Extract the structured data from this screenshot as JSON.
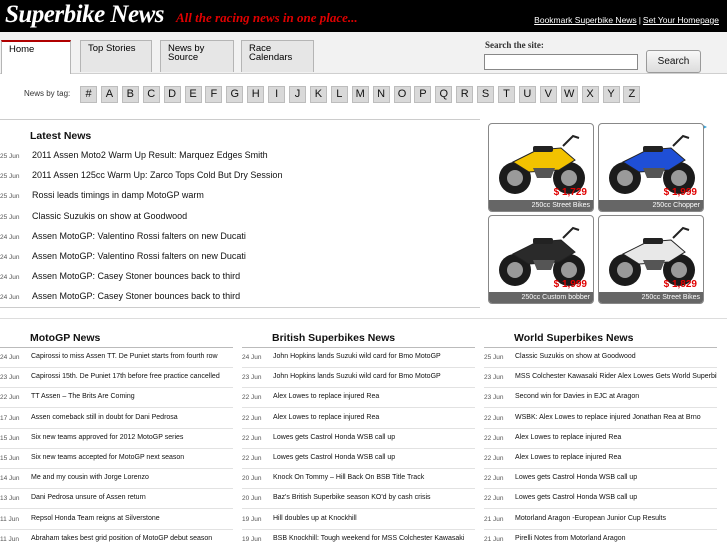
{
  "header": {
    "logo": "Superbike News",
    "tagline": "All the racing news in one place...",
    "link_bookmark": "Bookmark Superbike News",
    "separator": "|",
    "link_homepage": "Set Your Homepage"
  },
  "tabs": [
    {
      "label": "Home",
      "active": true
    },
    {
      "label": "Top Stories"
    },
    {
      "label": "News by Source"
    },
    {
      "label": "Race Calendars"
    }
  ],
  "search": {
    "label": "Search the site:",
    "value": "",
    "button": "Search"
  },
  "tags": {
    "label": "News by tag:",
    "letters": [
      "#",
      "A",
      "B",
      "C",
      "D",
      "E",
      "F",
      "G",
      "H",
      "I",
      "J",
      "K",
      "L",
      "M",
      "N",
      "O",
      "P",
      "Q",
      "R",
      "S",
      "T",
      "U",
      "V",
      "W",
      "X",
      "Y",
      "Z"
    ]
  },
  "latest": {
    "title": "Latest News",
    "items": [
      {
        "date": "25 Jun",
        "title": "2011 Assen Moto2 Warm Up Result: Marquez Edges Smith"
      },
      {
        "date": "25 Jun",
        "title": "2011 Assen 125cc Warm Up: Zarco Tops Cold But Dry Session"
      },
      {
        "date": "25 Jun",
        "title": "Rossi leads timings in damp MotoGP warm"
      },
      {
        "date": "25 Jun",
        "title": "Classic Suzukis on show at Goodwood"
      },
      {
        "date": "24 Jun",
        "title": "Assen MotoGP: Valentino Rossi falters on new Ducati"
      },
      {
        "date": "24 Jun",
        "title": "Assen MotoGP: Valentino Rossi falters on new Ducati"
      },
      {
        "date": "24 Jun",
        "title": "Assen MotoGP: Casey Stoner bounces back to third"
      },
      {
        "date": "24 Jun",
        "title": "Assen MotoGP: Casey Stoner bounces back to third"
      }
    ]
  },
  "ad": {
    "bikes": [
      {
        "price": "$ 1,729",
        "label": "250cc Street Bikes",
        "color": "#f2c200"
      },
      {
        "price": "$ 1,999",
        "label": "250cc Chopper",
        "color": "#1f4fd6"
      },
      {
        "price": "$ 1,999",
        "label": "250cc Custom bobber",
        "color": "#2a2a2a"
      },
      {
        "price": "$ 1,829",
        "label": "250cc Street Bikes",
        "color": "#e8e8e8"
      }
    ]
  },
  "columns": [
    {
      "title": "MotoGP News",
      "items": [
        {
          "date": "24 Jun",
          "title": "Capirossi to miss Assen TT. De Puniet starts from fourth row"
        },
        {
          "date": "23 Jun",
          "title": "Capirossi 15th. De Puniet 17th before free practice cancelled"
        },
        {
          "date": "22 Jun",
          "title": "TT Assen – The Brits Are Coming"
        },
        {
          "date": "17 Jun",
          "title": "Assen comeback still in doubt for Dani Pedrosa"
        },
        {
          "date": "15 Jun",
          "title": "Six new teams approved for 2012 MotoGP series"
        },
        {
          "date": "15 Jun",
          "title": "Six new teams accepted for MotoGP next season"
        },
        {
          "date": "14 Jun",
          "title": "Me and my cousin with Jorge Lorenzo"
        },
        {
          "date": "13 Jun",
          "title": "Dani Pedrosa unsure of Assen return"
        },
        {
          "date": "11 Jun",
          "title": "Repsol Honda Team reigns at Silverstone"
        },
        {
          "date": "11 Jun",
          "title": "Abraham takes best grid position of MotoGP debut season"
        }
      ]
    },
    {
      "title": "British Superbikes News",
      "items": [
        {
          "date": "24 Jun",
          "title": "John Hopkins lands Suzuki wild card for Bmo MotoGP"
        },
        {
          "date": "23 Jun",
          "title": "John Hopkins lands Suzuki wild card for Bmo MotoGP"
        },
        {
          "date": "22 Jun",
          "title": "Alex Lowes to replace injured Rea"
        },
        {
          "date": "22 Jun",
          "title": "Alex Lowes to replace injured Rea"
        },
        {
          "date": "22 Jun",
          "title": "Lowes gets Castrol Honda WSB call up"
        },
        {
          "date": "22 Jun",
          "title": "Lowes gets Castrol Honda WSB call up"
        },
        {
          "date": "20 Jun",
          "title": "Knock On Tommy – Hill Back On BSB Title Track"
        },
        {
          "date": "20 Jun",
          "title": "Baz's British Superbike season KO'd by cash crisis"
        },
        {
          "date": "19 Jun",
          "title": "Hill doubles up at Knockhill"
        },
        {
          "date": "19 Jun",
          "title": "BSB Knockhill: Tough weekend for MSS Colchester Kawasaki"
        }
      ]
    },
    {
      "title": "World Superbikes News",
      "items": [
        {
          "date": "25 Jun",
          "title": "Classic Suzukis on show at Goodwood"
        },
        {
          "date": "23 Jun",
          "title": "MSS Colchester Kawasaki Rider Alex Lowes Gets World Superbike"
        },
        {
          "date": "23 Jun",
          "title": "Second win for Davies in EJC at Aragon"
        },
        {
          "date": "22 Jun",
          "title": "WSBK: Alex Lowes to replace injured Jonathan Rea at Brno"
        },
        {
          "date": "22 Jun",
          "title": "Alex Lowes to replace injured Rea"
        },
        {
          "date": "22 Jun",
          "title": "Alex Lowes to replace injured Rea"
        },
        {
          "date": "22 Jun",
          "title": "Lowes gets Castrol Honda WSB call up"
        },
        {
          "date": "22 Jun",
          "title": "Lowes gets Castrol Honda WSB call up"
        },
        {
          "date": "21 Jun",
          "title": "Motorland Aragon -European Junior Cup Results"
        },
        {
          "date": "21 Jun",
          "title": "Pirelli Notes from Motorland Aragon"
        }
      ]
    }
  ]
}
